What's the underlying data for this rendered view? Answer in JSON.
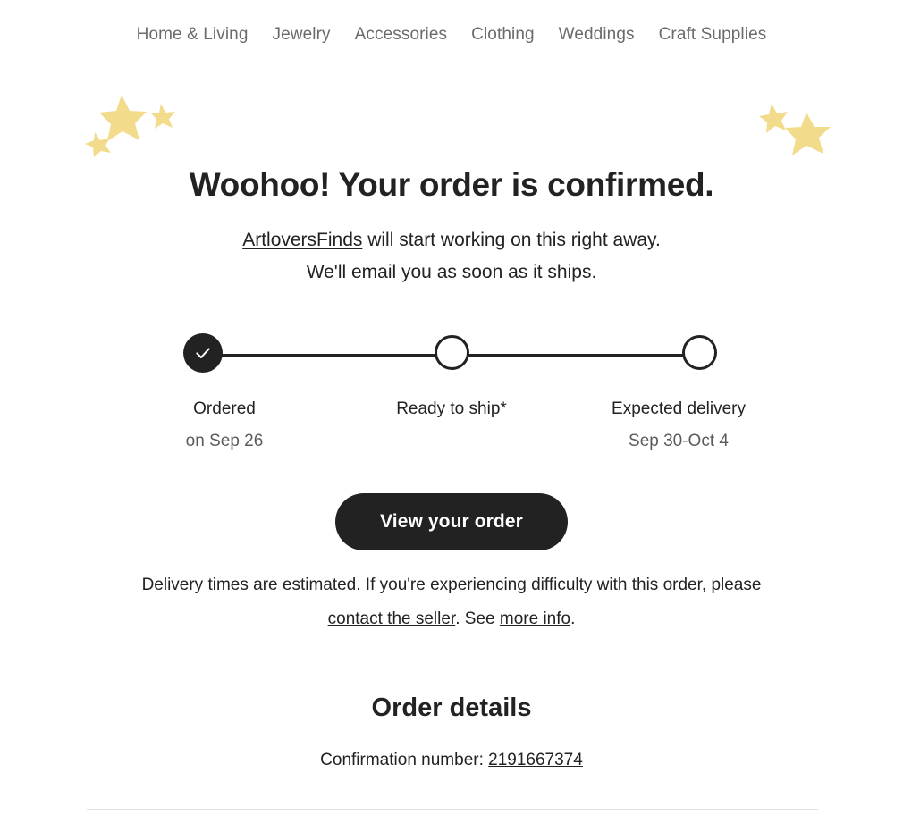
{
  "nav": {
    "items": [
      {
        "label": "Home & Living"
      },
      {
        "label": "Jewelry"
      },
      {
        "label": "Accessories"
      },
      {
        "label": "Clothing"
      },
      {
        "label": "Weddings"
      },
      {
        "label": "Craft Supplies"
      }
    ]
  },
  "decor": {
    "star_color": "#f2dc8c",
    "left_stars_name": "star-cluster-left",
    "right_stars_name": "star-cluster-right"
  },
  "hero": {
    "headline": "Woohoo! Your order is confirmed.",
    "shop_link": "ArtloversFinds",
    "subline_rest": " will start working on this right away.",
    "subline_second": "We'll email you as soon as it ships."
  },
  "tracker": {
    "steps": [
      {
        "label": "Ordered",
        "caption": "on Sep 26",
        "state": "done"
      },
      {
        "label": "Ready to ship*",
        "caption": "",
        "state": "todo"
      },
      {
        "label": "Expected delivery",
        "caption": "Sep 30-Oct 4",
        "state": "todo"
      }
    ]
  },
  "cta": {
    "label": "View your order"
  },
  "disclaimer": {
    "line1": "Delivery times are estimated. If you're experiencing difficulty with this order, please",
    "link_seller": "contact the seller",
    "middle": ". See ",
    "link_more": "more info",
    "end": "."
  },
  "order": {
    "title": "Order details",
    "confirmation_label": "Confirmation number: ",
    "confirmation_number": "2191667374"
  },
  "colors": {
    "accent_dark": "#222222",
    "nav_gray": "#6b6b6b",
    "caption_gray": "#5b5b5b",
    "divider": "#e1e1e1"
  }
}
